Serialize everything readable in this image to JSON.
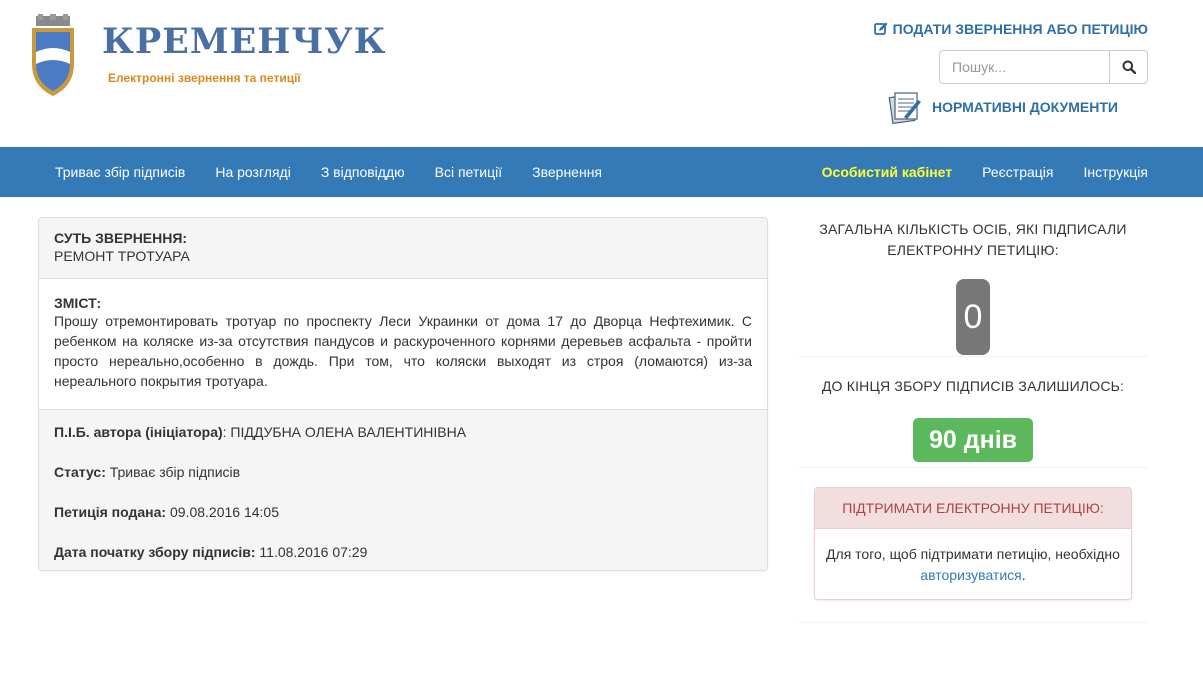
{
  "header": {
    "logo_title": "КРЕМЕНЧУК",
    "logo_subtitle": "Електронні звернення та петиції",
    "submit_link": "ПОДАТИ ЗВЕРНЕННЯ АБО ПЕТИЦІЮ",
    "search_placeholder": "Пошук...",
    "docs_link": "НОРМАТИВНІ ДОКУМЕНТИ"
  },
  "nav": {
    "left": [
      "Триває збір підписів",
      "На розгляді",
      "З відповіддю",
      "Всі петиції",
      "Звернення"
    ],
    "right": [
      "Особистий кабінет",
      "Реєстрація",
      "Інструкція"
    ]
  },
  "petition": {
    "essence_label": "СУТЬ ЗВЕРНЕННЯ:",
    "essence_value": "РЕМОНТ ТРОТУАРА",
    "content_label": "ЗМІСТ:",
    "content_value": "Прошу отремонтировать тротуар по проспекту Леси Украинки от дома 17 до Дворца Нефтехимик. С ребенком на коляске из-за отсутствия пандусов и раскуроченного корнями деревьев асфальта - пройти просто нереально,особенно в дождь. При том, что коляски выходят из строя (ломаются) из-за нереального покрытия тротуара.",
    "author_label": "П.І.Б. автора (ініціатора)",
    "author_value": "ПІДДУБНА ОЛЕНА ВАЛЕНТИНІВНА",
    "status_label": "Статус",
    "status_value": "Триває збір підписів",
    "submitted_label": "Петиція подана",
    "submitted_value": "09.08.2016 14:05",
    "start_label": "Дата початку збору підписів",
    "start_value": "11.08.2016 07:29"
  },
  "sidebar": {
    "signers_title": "ЗАГАЛЬНА КІЛЬКІСТЬ ОСІБ, ЯКІ ПІДПИСАЛИ ЕЛЕКТРОННУ ПЕТИЦІЮ:",
    "signers_count": "0",
    "remaining_title": "ДО КІНЦЯ ЗБОРУ ПІДПИСІВ ЗАЛИШИЛОСЬ:",
    "remaining_value": "90 днів",
    "support_title": "ПІДТРИМАТИ ЕЛЕКТРОННУ ПЕТИЦІЮ:",
    "support_text": "Для того, щоб підтримати петицію, необхідно",
    "support_link": "авторизуватися",
    "support_period": "."
  },
  "colors": {
    "navbar": "#337ab7",
    "highlight": "#ffff33",
    "badge_gray": "#777777",
    "badge_green": "#5cb85c"
  },
  "icons": [
    "edit-icon",
    "search-icon",
    "documents-icon",
    "coat-of-arms-icon"
  ]
}
